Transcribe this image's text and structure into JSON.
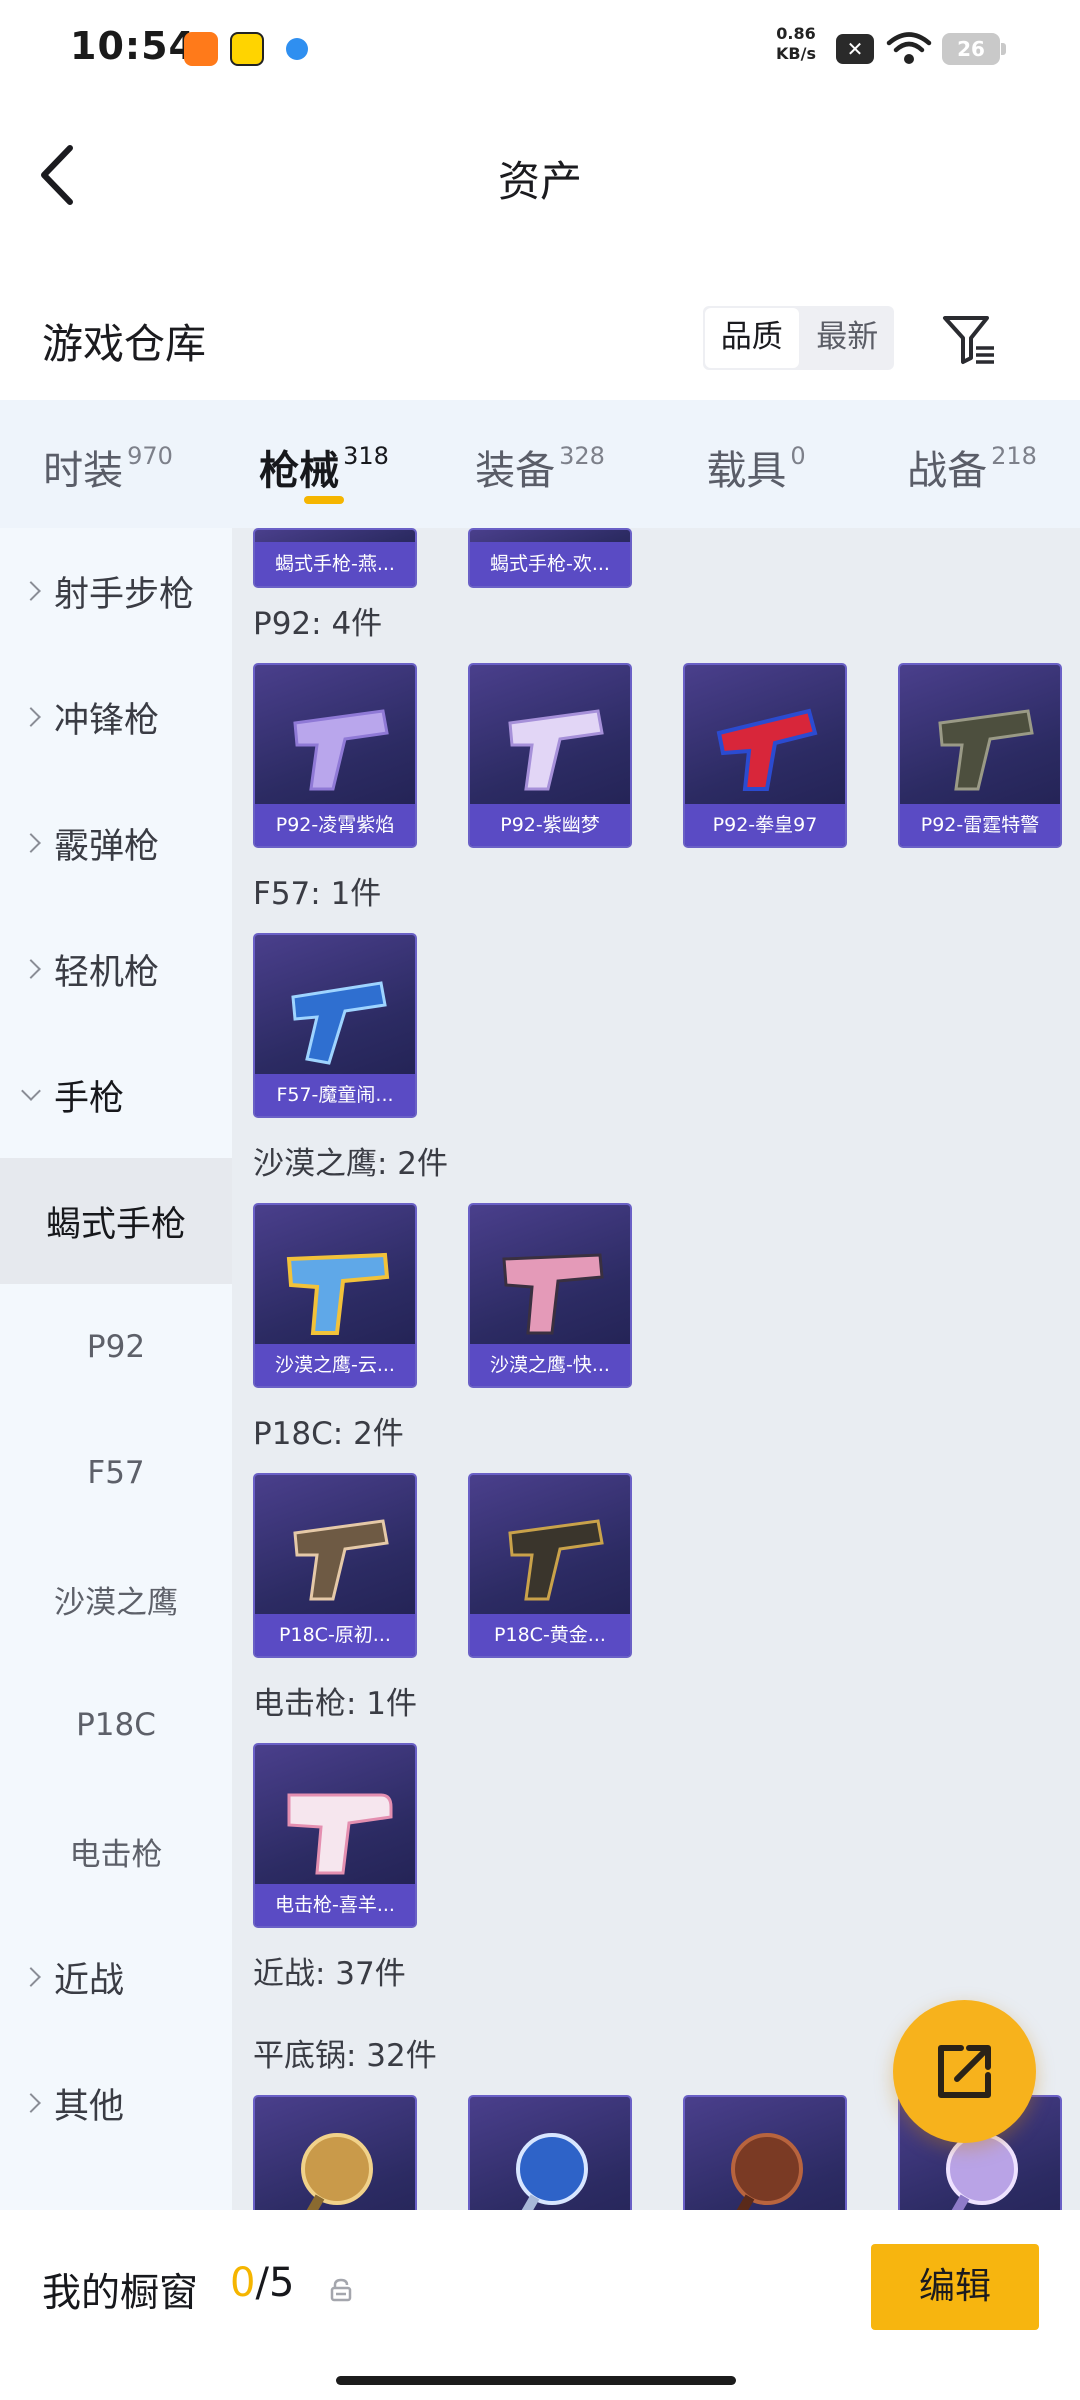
{
  "status_bar": {
    "time": "10:54",
    "net_speed_value": "0.86",
    "net_speed_unit": "KB/s",
    "battery": "26"
  },
  "header": {
    "title": "资产"
  },
  "warehouse": {
    "title": "游戏仓库",
    "sort_options": [
      "品质",
      "最新"
    ],
    "active_sort": "品质"
  },
  "tabs": [
    {
      "label": "时装",
      "count": "970"
    },
    {
      "label": "枪械",
      "count": "318",
      "active": true
    },
    {
      "label": "装备",
      "count": "328"
    },
    {
      "label": "载具",
      "count": "0"
    },
    {
      "label": "战备",
      "count": "218"
    }
  ],
  "sidebar": {
    "items": [
      {
        "label": "射手步枪",
        "type": "category"
      },
      {
        "label": "冲锋枪",
        "type": "category"
      },
      {
        "label": "霰弹枪",
        "type": "category"
      },
      {
        "label": "轻机枪",
        "type": "category"
      },
      {
        "label": "手枪",
        "type": "category",
        "expanded": true
      },
      {
        "label": "蝎式手枪",
        "type": "sub",
        "selected": true
      },
      {
        "label": "P92",
        "type": "sub"
      },
      {
        "label": "F57",
        "type": "sub"
      },
      {
        "label": "沙漠之鹰",
        "type": "sub"
      },
      {
        "label": "P18C",
        "type": "sub"
      },
      {
        "label": "电击枪",
        "type": "sub"
      },
      {
        "label": "近战",
        "type": "category"
      },
      {
        "label": "其他",
        "type": "category"
      }
    ]
  },
  "content": {
    "top_partial_items": [
      "蝎式手枪-燕...",
      "蝎式手枪-欢..."
    ],
    "groups": [
      {
        "title": "P92: 4件",
        "items": [
          "P92-凌霄紫焰",
          "P92-紫幽梦",
          "P92-拳皇97",
          "P92-雷霆特警"
        ]
      },
      {
        "title": "F57: 1件",
        "items": [
          "F57-魔童闹..."
        ]
      },
      {
        "title": "沙漠之鹰: 2件",
        "items": [
          "沙漠之鹰-云...",
          "沙漠之鹰-快..."
        ]
      },
      {
        "title": "P18C: 2件",
        "items": [
          "P18C-原初...",
          "P18C-黄金..."
        ]
      },
      {
        "title": "电击枪: 1件",
        "items": [
          "电击枪-喜羊..."
        ]
      }
    ],
    "melee_title": "近战: 37件",
    "pan_title": "平底锅: 32件"
  },
  "bottom_bar": {
    "title": "我的橱窗",
    "current": "0",
    "separator": "/",
    "max": "5",
    "edit_label": "编辑"
  },
  "colors": {
    "accent": "#f7b50f",
    "card_bg": "#2c2b63",
    "card_caption": "#5a4bc4"
  }
}
